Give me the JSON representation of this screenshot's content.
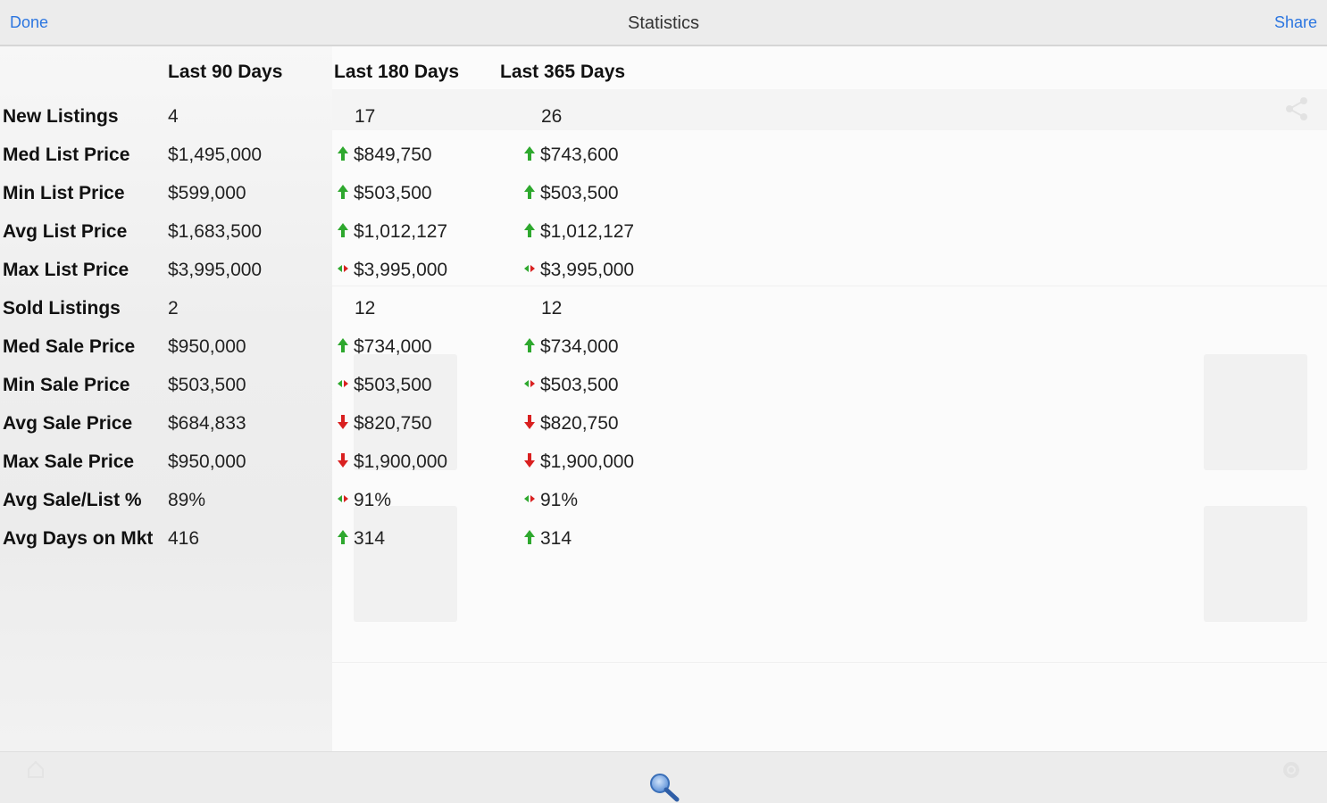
{
  "nav": {
    "title": "Statistics",
    "done_label": "Done",
    "share_label": "Share"
  },
  "colors": {
    "accent": "#2c76e0",
    "up": "#2ea82e",
    "down": "#d92020"
  },
  "stats": {
    "columns": [
      "Last 90 Days",
      "Last 180 Days",
      "Last 365 Days"
    ],
    "rows": [
      {
        "label": "New Listings",
        "d90": "4",
        "d180": "17",
        "d180_trend": "none",
        "d365": "26",
        "d365_trend": "none"
      },
      {
        "label": "Med List Price",
        "d90": "$1,495,000",
        "d180": "$849,750",
        "d180_trend": "up",
        "d365": "$743,600",
        "d365_trend": "up"
      },
      {
        "label": "Min List Price",
        "d90": "$599,000",
        "d180": "$503,500",
        "d180_trend": "up",
        "d365": "$503,500",
        "d365_trend": "up"
      },
      {
        "label": "Avg List Price",
        "d90": "$1,683,500",
        "d180": "$1,012,127",
        "d180_trend": "up",
        "d365": "$1,012,127",
        "d365_trend": "up"
      },
      {
        "label": "Max List Price",
        "d90": "$3,995,000",
        "d180": "$3,995,000",
        "d180_trend": "same",
        "d365": "$3,995,000",
        "d365_trend": "same"
      },
      {
        "label": "Sold Listings",
        "d90": "2",
        "d180": "12",
        "d180_trend": "none",
        "d365": "12",
        "d365_trend": "none"
      },
      {
        "label": "Med Sale Price",
        "d90": "$950,000",
        "d180": "$734,000",
        "d180_trend": "up",
        "d365": "$734,000",
        "d365_trend": "up"
      },
      {
        "label": "Min Sale Price",
        "d90": "$503,500",
        "d180": "$503,500",
        "d180_trend": "same",
        "d365": "$503,500",
        "d365_trend": "same"
      },
      {
        "label": "Avg Sale Price",
        "d90": "$684,833",
        "d180": "$820,750",
        "d180_trend": "down",
        "d365": "$820,750",
        "d365_trend": "down"
      },
      {
        "label": "Max Sale Price",
        "d90": "$950,000",
        "d180": "$1,900,000",
        "d180_trend": "down",
        "d365": "$1,900,000",
        "d365_trend": "down"
      },
      {
        "label": "Avg Sale/List %",
        "d90": "89%",
        "d180": "91%",
        "d180_trend": "same",
        "d365": "91%",
        "d365_trend": "same"
      },
      {
        "label": "Avg Days on Mkt",
        "d90": "416",
        "d180": "314",
        "d180_trend": "up",
        "d365": "314",
        "d365_trend": "up"
      }
    ]
  },
  "toolbar": {
    "search_icon": "search-icon"
  }
}
